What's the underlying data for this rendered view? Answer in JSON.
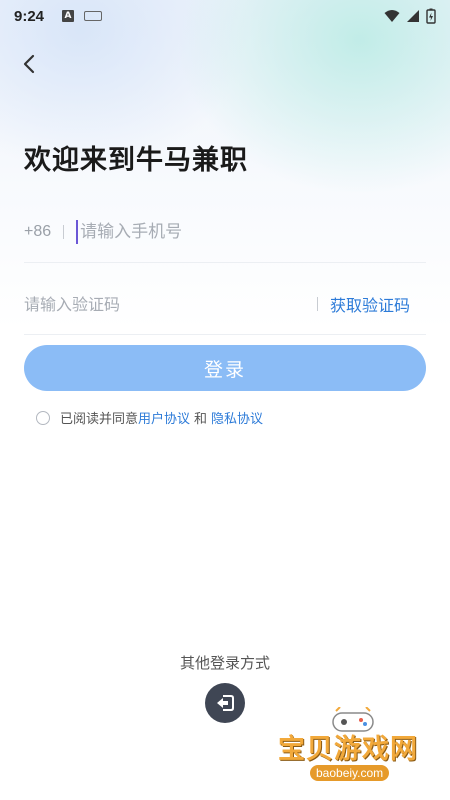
{
  "status_bar": {
    "time": "9:24",
    "a_badge": "A"
  },
  "title": "欢迎来到牛马兼职",
  "phone": {
    "prefix": "+86",
    "placeholder": "请输入手机号"
  },
  "code": {
    "placeholder": "请输入验证码",
    "get_code_label": "获取验证码"
  },
  "login_label": "登录",
  "agreement": {
    "prefix": "已阅读并同意",
    "user_agreement": "用户协议",
    "and": "和",
    "privacy": "隐私协议"
  },
  "other_login_label": "其他登录方式",
  "watermark": {
    "text": "宝贝游戏网",
    "url": "baobeiy.com"
  },
  "colors": {
    "accent": "#2d7bd8",
    "login_button": "#8bbcf6",
    "other_login_icon_bg": "#3f4654"
  },
  "icons": {
    "back": "chevron-left-icon",
    "other_login": "login-exit-icon"
  }
}
